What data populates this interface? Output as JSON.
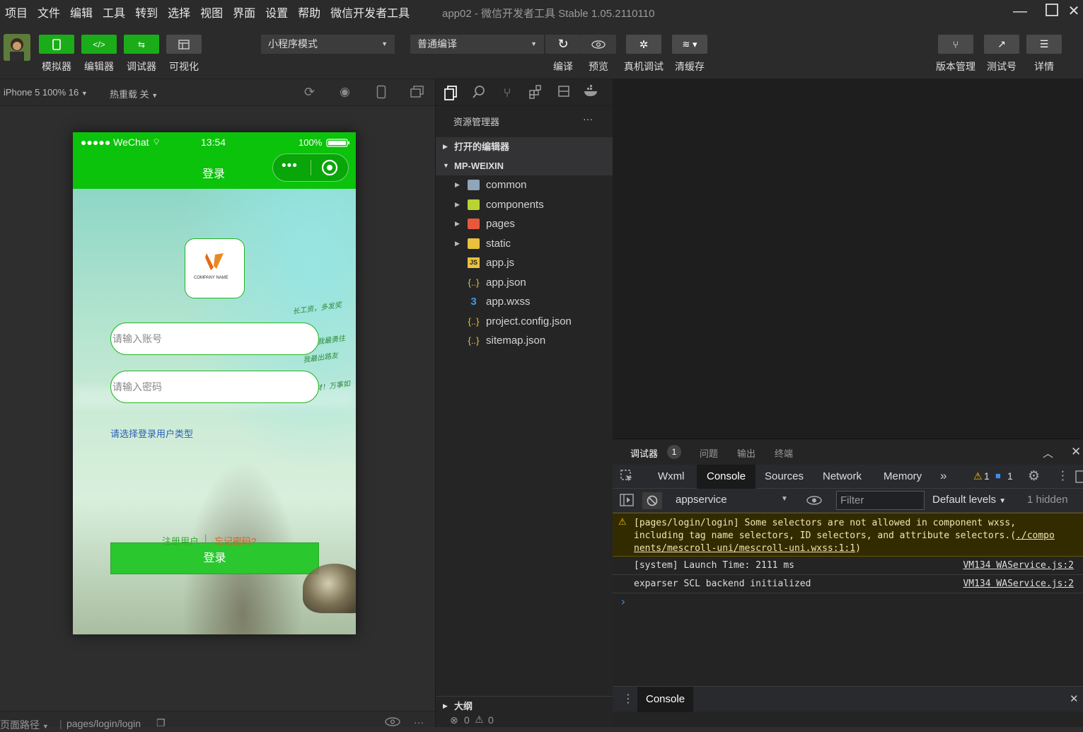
{
  "menu": [
    "项目",
    "文件",
    "编辑",
    "工具",
    "转到",
    "选择",
    "视图",
    "界面",
    "设置",
    "帮助",
    "微信开发者工具"
  ],
  "window_title": "app02 - 微信开发者工具 Stable 1.05.2110110",
  "toolbar": {
    "simulator": "模拟器",
    "editor": "编辑器",
    "debugger": "调试器",
    "visual": "可视化",
    "mode_select": "小程序模式",
    "compile_select": "普通编译",
    "compile": "编译",
    "preview": "预览",
    "device_debug": "真机调试",
    "clear_cache": "清缓存",
    "version": "版本管理",
    "test": "测试号",
    "details": "详情"
  },
  "sim": {
    "device": "iPhone 5 100% 16",
    "hot_reload": "热重载 关",
    "status_carrier": "●●●●● WeChat",
    "status_time": "13:54",
    "status_battery": "100%",
    "nav_title": "登录",
    "logo_text": "COMPANY NAME",
    "account_placeholder": "请输入账号",
    "password_placeholder": "请输入密码",
    "user_type": "请选择登录用户类型",
    "login_button": "登录",
    "register": "注册用户",
    "separator": "|",
    "forgot": "忘记密码?",
    "deco_lines": [
      "长工资，多发奖",
      "我最勇往",
      "我最出路友",
      "恭喜发财！万事如"
    ]
  },
  "statusbar": {
    "page_path_label": "页面路径",
    "page_path": "pages/login/login",
    "errors": "0",
    "warnings": "0"
  },
  "explorer": {
    "title": "资源管理器",
    "open_editors": "打开的编辑器",
    "project": "MP-WEIXIN",
    "outline": "大纲",
    "items": [
      {
        "name": "common",
        "type": "folder"
      },
      {
        "name": "components",
        "type": "folder"
      },
      {
        "name": "pages",
        "type": "folder"
      },
      {
        "name": "static",
        "type": "folder"
      },
      {
        "name": "app.js",
        "type": "js"
      },
      {
        "name": "app.json",
        "type": "json"
      },
      {
        "name": "app.wxss",
        "type": "wxss"
      },
      {
        "name": "project.config.json",
        "type": "json"
      },
      {
        "name": "sitemap.json",
        "type": "json"
      }
    ]
  },
  "debugger": {
    "tabs": [
      "调试器",
      "问题",
      "输出",
      "终端"
    ],
    "badge": "1",
    "devtools_tabs": [
      "Wxml",
      "Console",
      "Sources",
      "Network",
      "Memory"
    ],
    "more": "»",
    "warn_count": "1",
    "info_count": "1",
    "context": "appservice",
    "filter_placeholder": "Filter",
    "levels": "Default levels",
    "hidden": "1 hidden",
    "warn_message_1": "[pages/login/login] Some selectors are not allowed in component wxss,",
    "warn_message_2": "including tag name selectors, ID selectors, and attribute selectors.(",
    "warn_link_1": "./compo",
    "warn_link_2": "nents/mescroll-uni/mescroll-uni.wxss:1:1",
    "warn_tail": ")",
    "log1": "[system] Launch Time: 2111 ms",
    "log1_src": "VM134 WAService.js:2",
    "log2": "exparser SCL backend initialized",
    "log2_src": "VM134 WAService.js:2",
    "prompt": "›",
    "drawer_tab": "Console"
  }
}
